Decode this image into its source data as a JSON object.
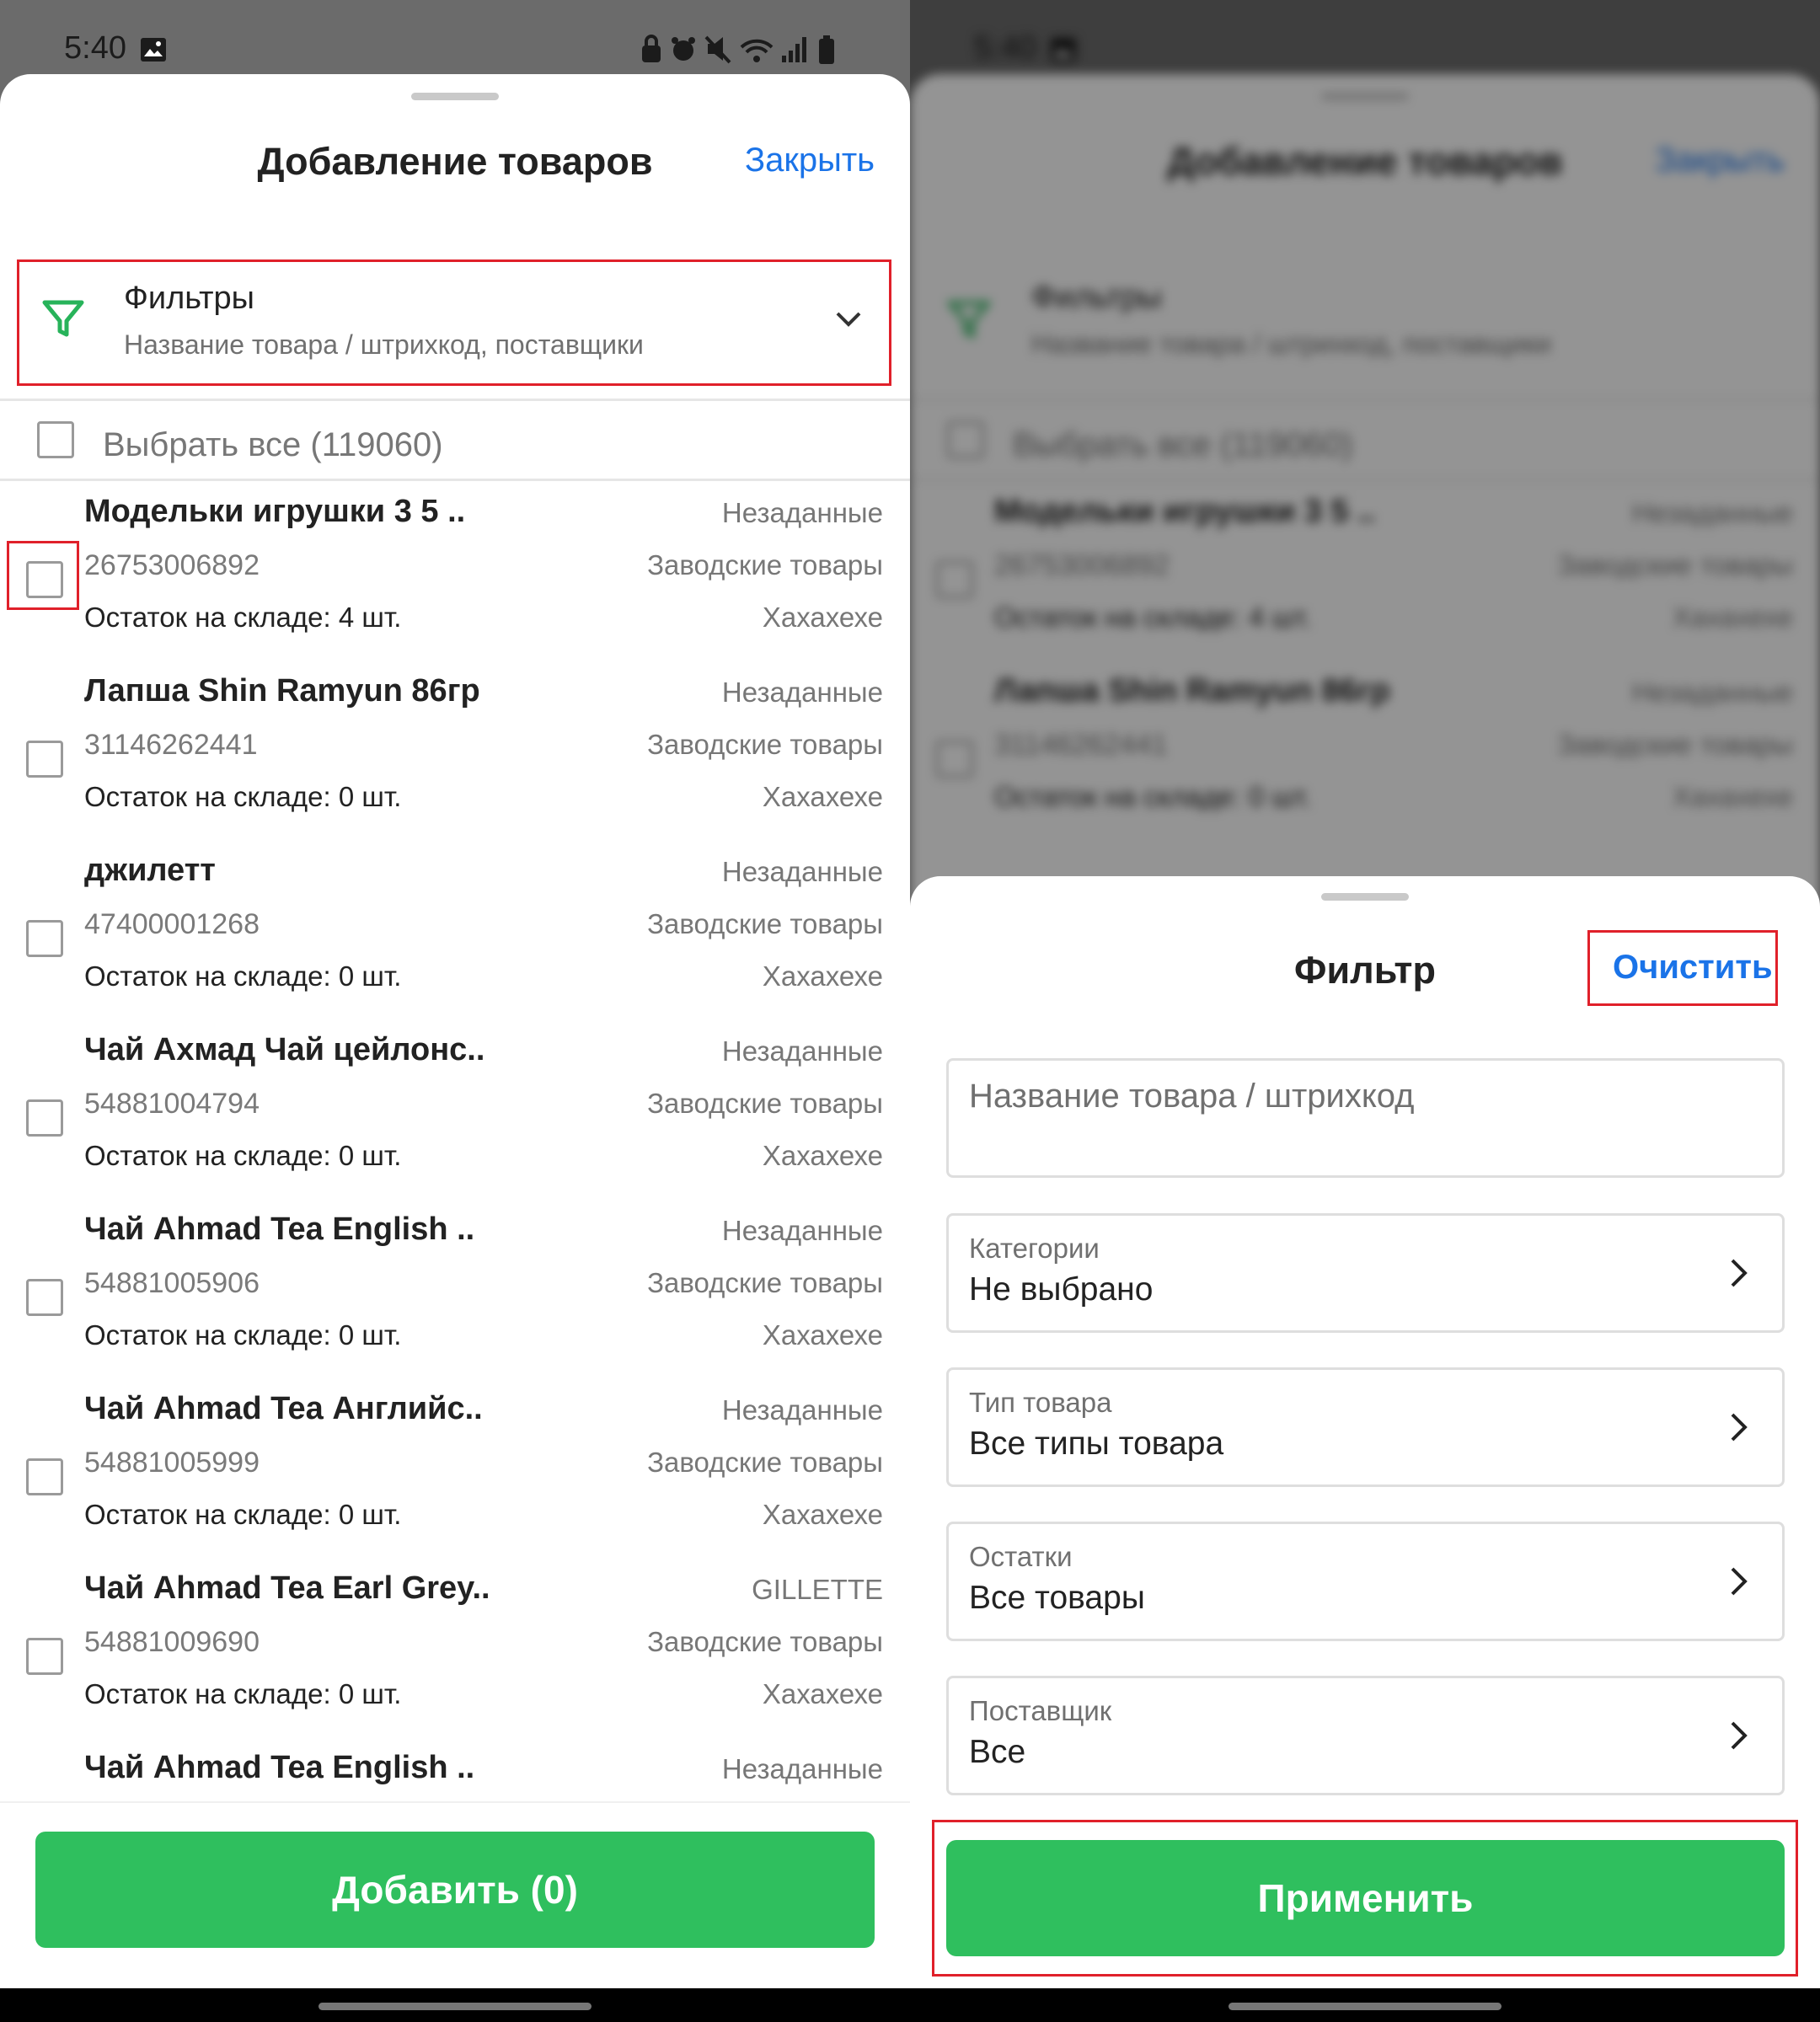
{
  "status": {
    "time": "5:40"
  },
  "left": {
    "title": "Добавление товаров",
    "close_label": "Закрыть",
    "filters": {
      "title": "Фильтры",
      "subtitle": "Название товара / штрихкод, поставщики"
    },
    "select_all": "Выбрать все (119060)",
    "items": [
      {
        "name": "Модельки игрушки 3 5 ..",
        "barcode": "26753006892",
        "stock": "Остаток на складе: 4 шт.",
        "tag1": "Незаданные",
        "tag2": "Заводские товары",
        "tag3": "Хахахехе"
      },
      {
        "name": "Лапша Shin Ramyun 86гр",
        "barcode": "31146262441",
        "stock": "Остаток на складе: 0 шт.",
        "tag1": "Незаданные",
        "tag2": "Заводские товары",
        "tag3": "Хахахехе"
      },
      {
        "name": "джилетт",
        "barcode": "47400001268",
        "stock": "Остаток на складе: 0 шт.",
        "tag1": "Незаданные",
        "tag2": "Заводские товары",
        "tag3": "Хахахехе"
      },
      {
        "name": "Чай Ахмад Чай цейлонс..",
        "barcode": "54881004794",
        "stock": "Остаток на складе: 0 шт.",
        "tag1": "Незаданные",
        "tag2": "Заводские товары",
        "tag3": "Хахахехе"
      },
      {
        "name": "Чай Ahmad Tea English ..",
        "barcode": "54881005906",
        "stock": "Остаток на складе: 0 шт.",
        "tag1": "Незаданные",
        "tag2": "Заводские товары",
        "tag3": "Хахахехе"
      },
      {
        "name": "Чай Ahmad Tea Английс..",
        "barcode": "54881005999",
        "stock": "Остаток на складе: 0 шт.",
        "tag1": "Незаданные",
        "tag2": "Заводские товары",
        "tag3": "Хахахехе"
      },
      {
        "name": "Чай Ahmad Tea Earl Grey..",
        "barcode": "54881009690",
        "stock": "Остаток на складе: 0 шт.",
        "tag1": "GILLETTE",
        "tag2": "Заводские товары",
        "tag3": "Хахахехе"
      },
      {
        "name": "Чай Ahmad Tea English ..",
        "barcode": "",
        "stock": "",
        "tag1": "Незаданные",
        "tag2": "",
        "tag3": ""
      }
    ],
    "add_button": "Добавить (0)"
  },
  "right": {
    "title": "Фильтр",
    "clear_label": "Очистить",
    "search_placeholder": "Название товара / штрихкод",
    "fields": [
      {
        "label": "Категории",
        "value": "Не выбрано"
      },
      {
        "label": "Тип товара",
        "value": "Все типы товара"
      },
      {
        "label": "Остатки",
        "value": "Все товары"
      },
      {
        "label": "Поставщик",
        "value": "Все"
      }
    ],
    "apply_button": "Применить"
  },
  "colors": {
    "accent_green": "#2fbf5e",
    "link_blue": "#1a73e8",
    "highlight_red": "#e0202a",
    "funnel_green": "#27b35a"
  }
}
